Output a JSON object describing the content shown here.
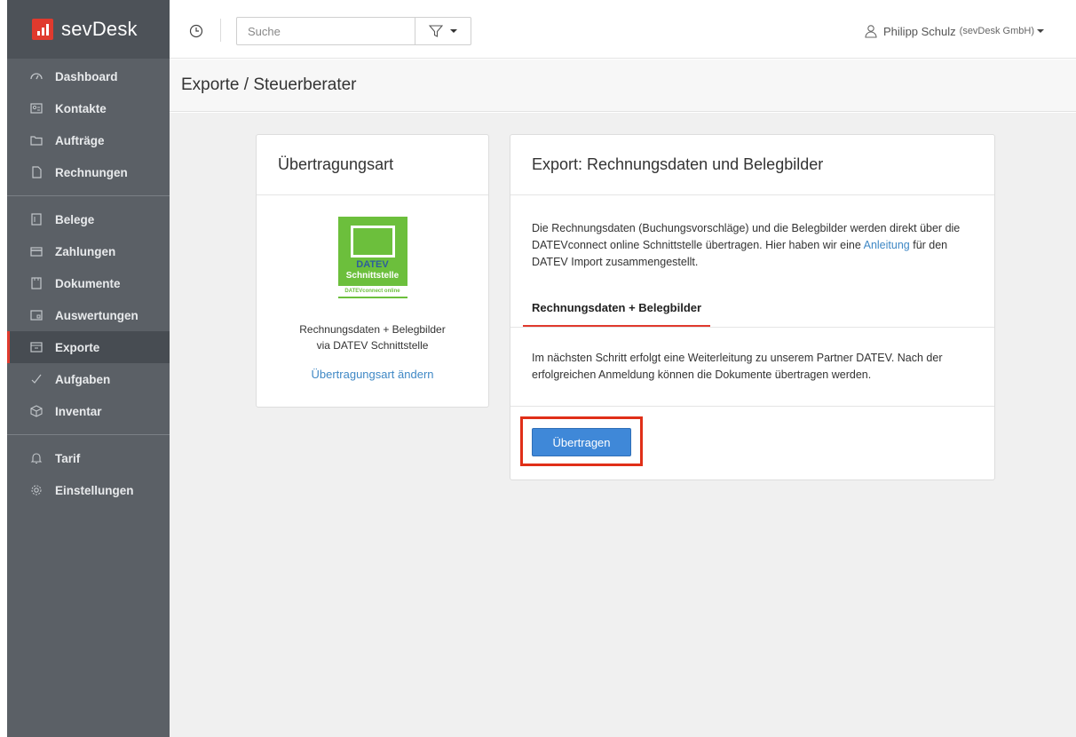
{
  "brand": {
    "name": "sevDesk",
    "colors": {
      "accent": "#e03a2e",
      "sidebar": "#5b6066",
      "link": "#3f88c5",
      "button": "#3f88d8"
    }
  },
  "sidebar": {
    "groups": [
      [
        {
          "label": "Dashboard",
          "icon": "dashboard-icon"
        },
        {
          "label": "Kontakte",
          "icon": "contacts-icon"
        },
        {
          "label": "Aufträge",
          "icon": "folder-icon"
        },
        {
          "label": "Rechnungen",
          "icon": "document-icon"
        }
      ],
      [
        {
          "label": "Belege",
          "icon": "receipt-icon"
        },
        {
          "label": "Zahlungen",
          "icon": "card-icon"
        },
        {
          "label": "Dokumente",
          "icon": "documents-icon"
        },
        {
          "label": "Auswertungen",
          "icon": "report-icon"
        },
        {
          "label": "Exporte",
          "icon": "export-icon",
          "active": true
        },
        {
          "label": "Aufgaben",
          "icon": "check-icon"
        },
        {
          "label": "Inventar",
          "icon": "box-icon"
        }
      ],
      [
        {
          "label": "Tarif",
          "icon": "bell-icon"
        },
        {
          "label": "Einstellungen",
          "icon": "gear-icon"
        }
      ]
    ]
  },
  "topbar": {
    "search": {
      "placeholder": "Suche",
      "value": ""
    },
    "user": {
      "name": "Philipp Schulz",
      "company": "(sevDesk GmbH)"
    }
  },
  "page": {
    "title": "Exporte / Steuerberater"
  },
  "transfer_type_card": {
    "title": "Übertragungsart",
    "logo": {
      "brand": "DATEV",
      "subtitle": "Schnittstelle",
      "tagline": "DATEVconnect online"
    },
    "description_line1": "Rechnungsdaten + Belegbilder",
    "description_line2": "via DATEV Schnittstelle",
    "change_link": "Übertragungsart ändern"
  },
  "export_card": {
    "title": "Export: Rechnungsdaten und Belegbilder",
    "desc_before": "Die Rechnungsdaten (Buchungsvorschläge) und die Belegbilder werden direkt über die DATEVconnect online Schnittstelle übertragen. Hier haben wir eine",
    "desc_link": "Anleitung",
    "desc_after": "für den DATEV Import zusammengestellt.",
    "tab_label": "Rechnungsdaten + Belegbilder",
    "info": "Im nächsten Schritt erfolgt eine Weiterleitung zu unserem Partner DATEV. Nach der erfolgreichen Anmeldung können die Dokumente übertragen werden.",
    "submit_label": "Übertragen"
  }
}
